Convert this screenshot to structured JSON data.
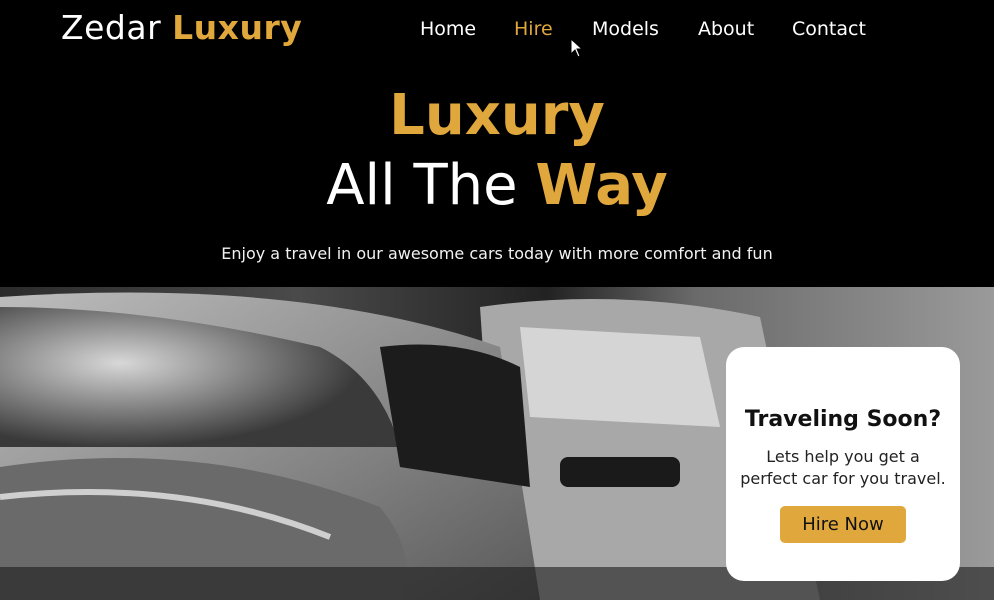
{
  "colors": {
    "accent": "#e0a83c",
    "background": "#000000",
    "card": "#ffffff"
  },
  "logo": {
    "part1": "Zedar ",
    "part2": "Luxury"
  },
  "nav": {
    "items": [
      {
        "label": "Home",
        "active": false
      },
      {
        "label": "Hire",
        "active": true
      },
      {
        "label": "Models",
        "active": false
      },
      {
        "label": "About",
        "active": false
      },
      {
        "label": "Contact",
        "active": false
      }
    ]
  },
  "hero": {
    "line1": "Luxury",
    "line2_a": "All The ",
    "line2_b": "Way",
    "subtitle": "Enjoy a travel in our awesome cars today with more comfort and fun"
  },
  "card": {
    "title": "Traveling Soon?",
    "text": "Lets help you get a perfect car for you travel.",
    "button": "Hire Now"
  }
}
